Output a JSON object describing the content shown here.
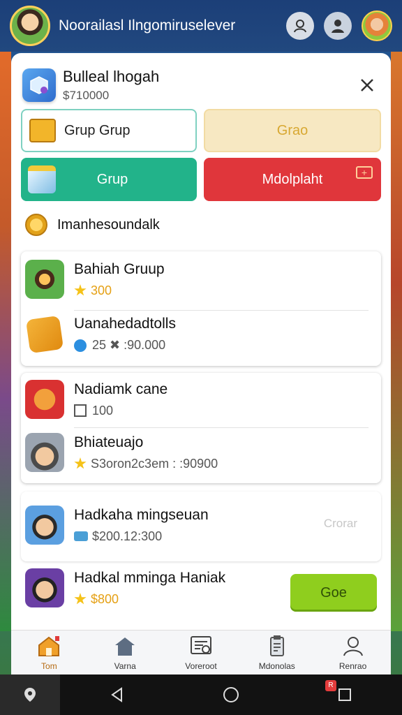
{
  "topbar": {
    "title": "Noorailasl Ilngomiruselever",
    "icons": [
      "person-icon",
      "badge-icon",
      "profile-avatar"
    ]
  },
  "header": {
    "title": "Bulleal lhogah",
    "subtitle": "$710000",
    "close_icon": "close-icon"
  },
  "buttons": {
    "grup_outline": "Grup Grup",
    "grao": "Grao",
    "grup_green": "Grup",
    "red": "Mdolplaht",
    "red_plus": "+"
  },
  "coin_row": {
    "label": "Imanhesoundalk"
  },
  "cards": [
    {
      "rows": [
        {
          "title": "Bahiah Gruup",
          "meta": "300",
          "meta_icon": "star-icon"
        },
        {
          "title": "Uanahedadtolls",
          "meta": "25 ✖ :90.000",
          "meta_icon": "blue-dot-icon"
        }
      ]
    },
    {
      "rows": [
        {
          "title": "Nadiamk cane",
          "meta": "100",
          "meta_icon": "grid-icon"
        },
        {
          "title": "Bhiateuajo",
          "meta": "S3oron2c3em : :90900",
          "meta_icon": "star-icon"
        }
      ]
    },
    {
      "rows": [
        {
          "title": "Hadkaha mingseuan",
          "meta": "$200.12:300",
          "meta_icon": "stack-icon"
        }
      ],
      "cta": "Crorar"
    }
  ],
  "last_row": {
    "title": "Hadkal mminga Haniak",
    "meta": "$800",
    "button": "Goe"
  },
  "bottomnav": {
    "items": [
      {
        "label": "Tom",
        "icon": "home-icon",
        "active": true
      },
      {
        "label": "Varna",
        "icon": "house-icon",
        "active": false
      },
      {
        "label": "Voreroot",
        "icon": "document-icon",
        "active": false
      },
      {
        "label": "Mdonolas",
        "icon": "clipboard-icon",
        "active": false
      },
      {
        "label": "Renrao",
        "icon": "user-icon",
        "active": false
      }
    ]
  },
  "system": {
    "badge": "R"
  }
}
